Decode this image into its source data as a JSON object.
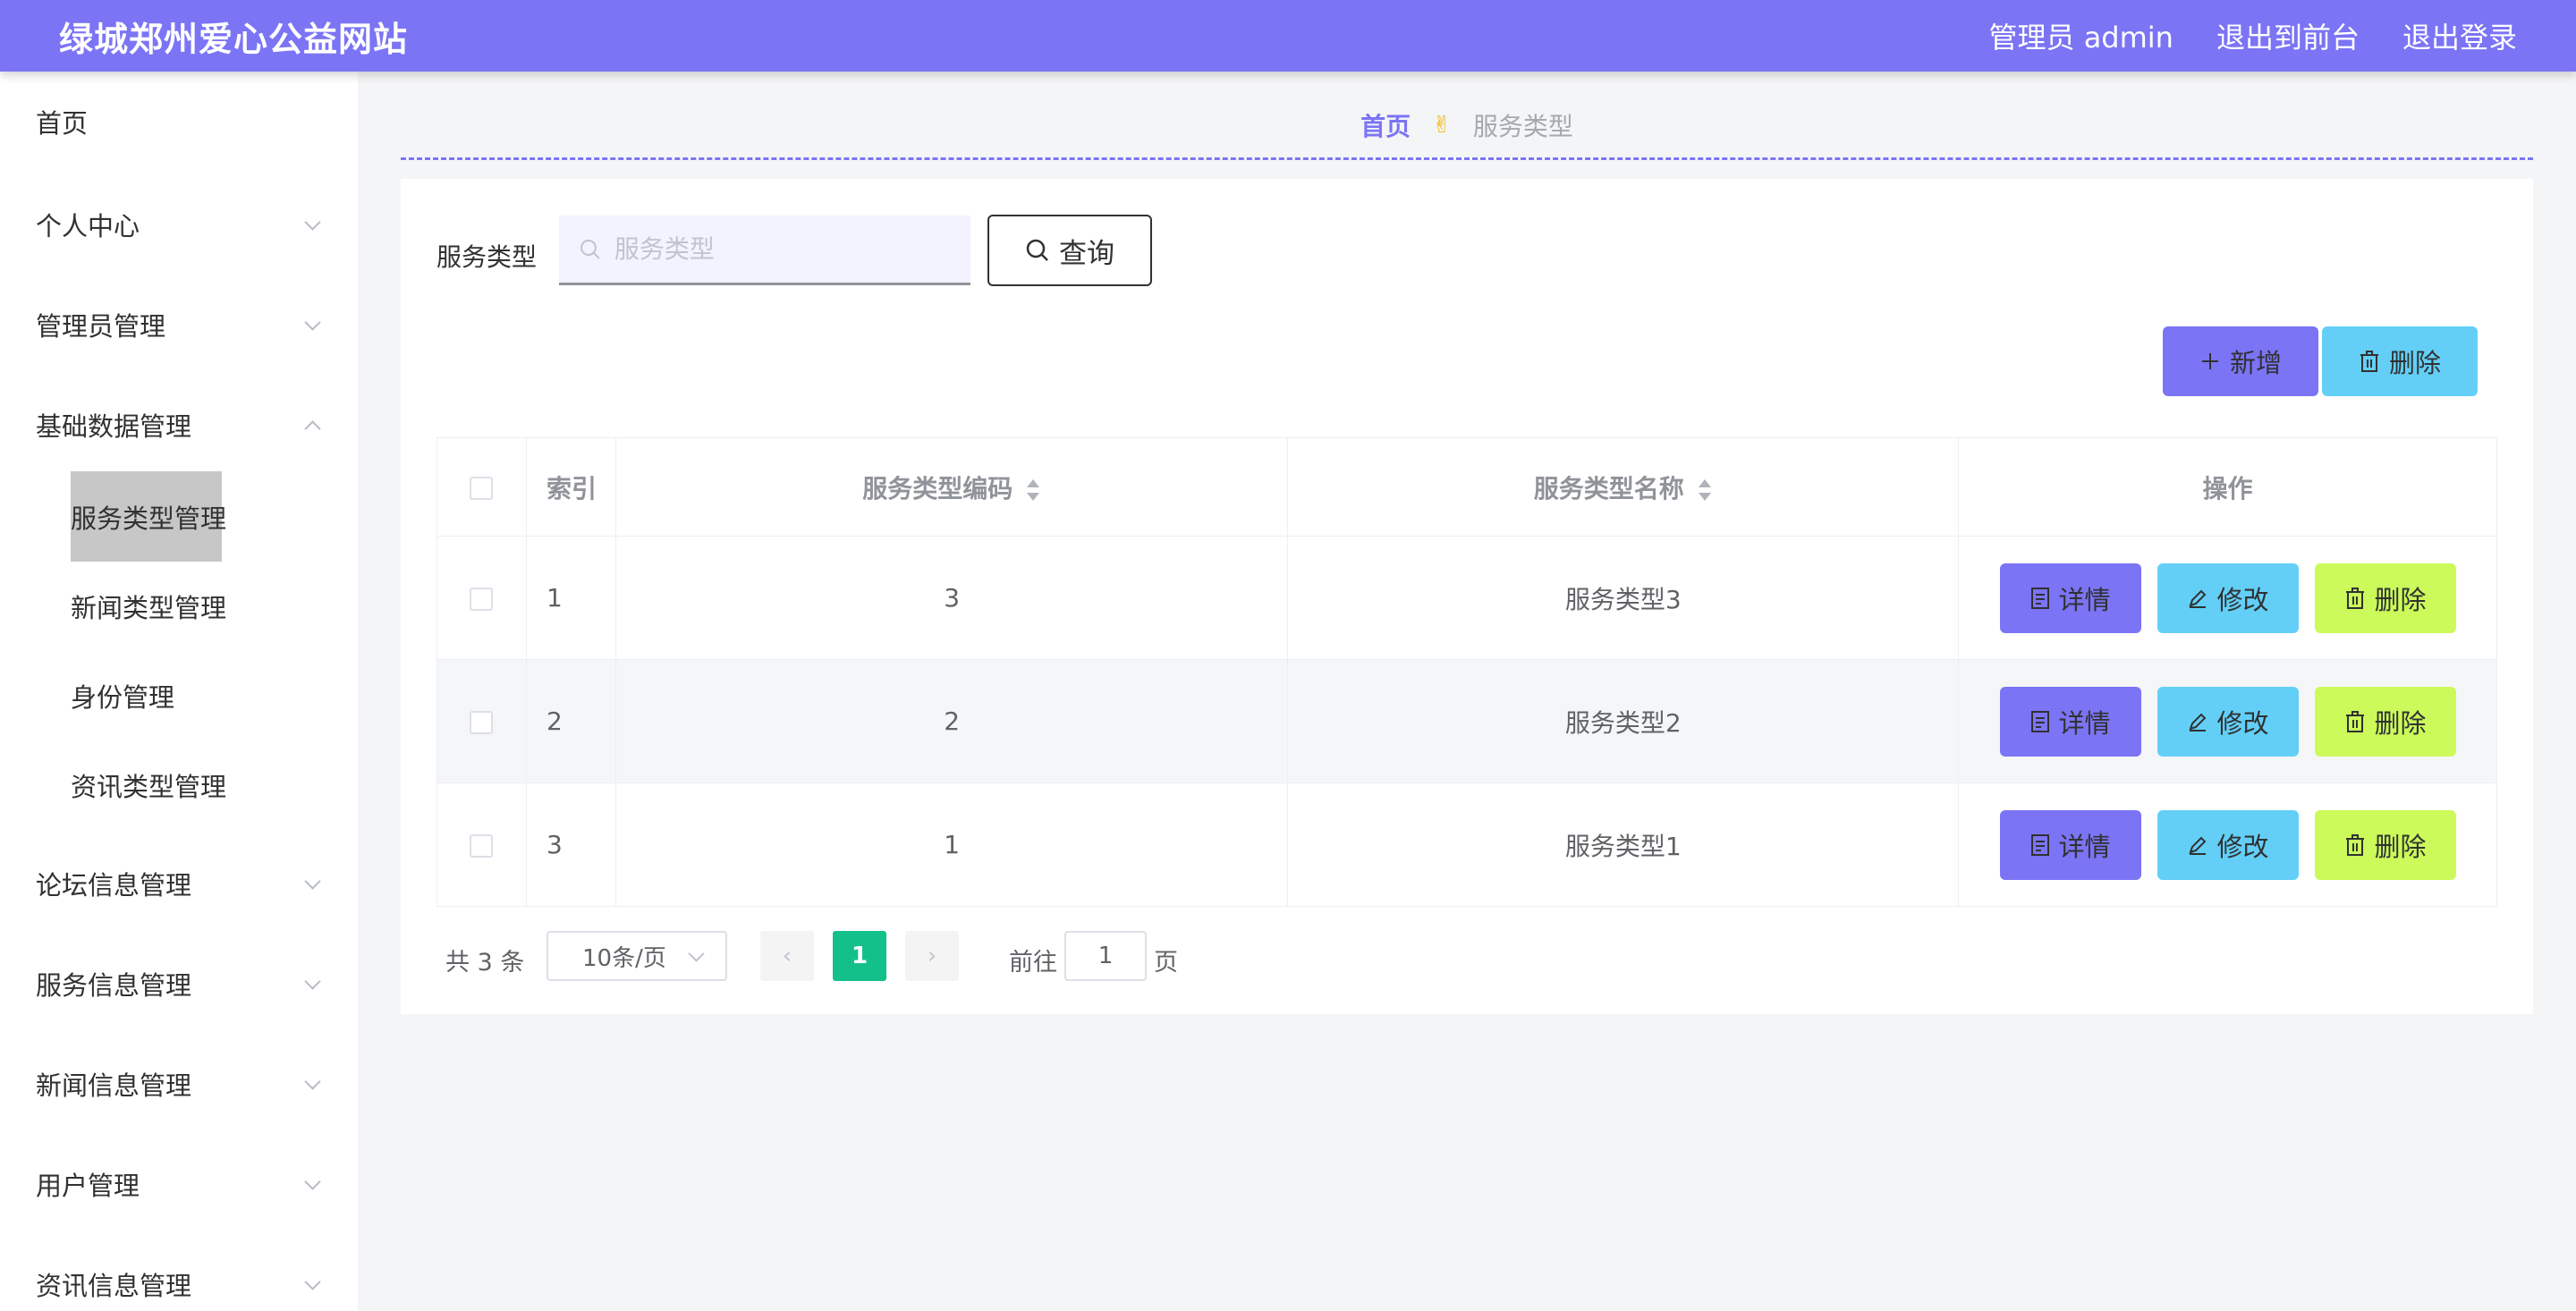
{
  "header": {
    "title": "绿城郑州爱心公益网站",
    "admin_label": "管理员 admin",
    "to_front": "退出到前台",
    "logout": "退出登录"
  },
  "sidebar": {
    "items": [
      {
        "label": "首页"
      },
      {
        "label": "个人中心"
      },
      {
        "label": "管理员管理"
      },
      {
        "label": "基础数据管理"
      },
      {
        "label": "论坛信息管理"
      },
      {
        "label": "服务信息管理"
      },
      {
        "label": "新闻信息管理"
      },
      {
        "label": "用户管理"
      },
      {
        "label": "资讯信息管理"
      }
    ],
    "sub_items": [
      {
        "label": "服务类型管理"
      },
      {
        "label": "新闻类型管理"
      },
      {
        "label": "身份管理"
      },
      {
        "label": "资讯类型管理"
      }
    ]
  },
  "breadcrumb": {
    "home": "首页",
    "separator": "✌",
    "current": "服务类型"
  },
  "search": {
    "label": "服务类型",
    "placeholder": "服务类型",
    "button": "查询"
  },
  "actions": {
    "add": "新增",
    "delete": "删除"
  },
  "table": {
    "headers": {
      "index": "索引",
      "code": "服务类型编码",
      "name": "服务类型名称",
      "ops": "操作"
    },
    "rows": [
      {
        "index": "1",
        "code": "3",
        "name": "服务类型3"
      },
      {
        "index": "2",
        "code": "2",
        "name": "服务类型2"
      },
      {
        "index": "3",
        "code": "1",
        "name": "服务类型1"
      }
    ],
    "op_labels": {
      "detail": "详情",
      "edit": "修改",
      "delete": "删除"
    }
  },
  "pagination": {
    "total": "共 3 条",
    "page_size": "10条/页",
    "current_page": "1",
    "goto_label": "前往",
    "goto_value": "1",
    "page_suffix": "页"
  },
  "colors": {
    "primary": "#7b74f5",
    "info": "#63cff7",
    "lime": "#cbfa5a",
    "success": "#13c08a"
  }
}
